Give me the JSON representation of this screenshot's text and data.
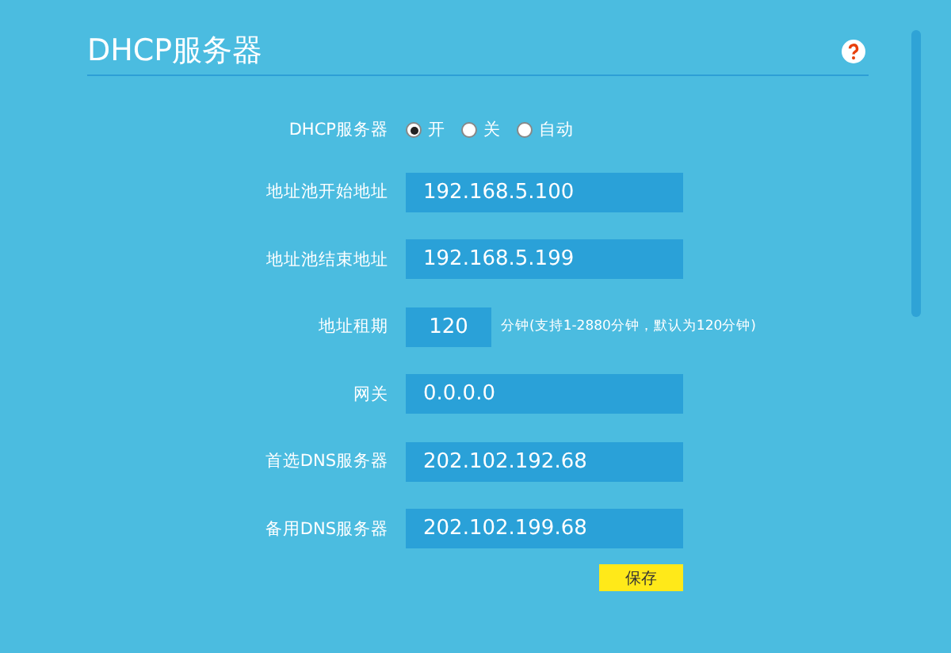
{
  "title": "DHCP服务器",
  "rows": [
    {
      "kind": "radio",
      "label": "DHCP服务器",
      "options": [
        {
          "label": "开",
          "selected": true
        },
        {
          "label": "关",
          "selected": false
        },
        {
          "label": "自动",
          "selected": false
        }
      ]
    },
    {
      "kind": "text",
      "label": "地址池开始地址",
      "value": "192.168.5.100"
    },
    {
      "kind": "text",
      "label": "地址池结束地址",
      "value": "192.168.5.199"
    },
    {
      "kind": "short",
      "label": "地址租期",
      "value": "120",
      "note": "分钟(支持1-2880分钟，默认为120分钟)"
    },
    {
      "kind": "text",
      "label": "网关",
      "value": "0.0.0.0"
    },
    {
      "kind": "text",
      "label": "首选DNS服务器",
      "value": "202.102.192.68"
    },
    {
      "kind": "text",
      "label": "备用DNS服务器",
      "value": "202.102.199.68"
    }
  ],
  "save": "保存"
}
